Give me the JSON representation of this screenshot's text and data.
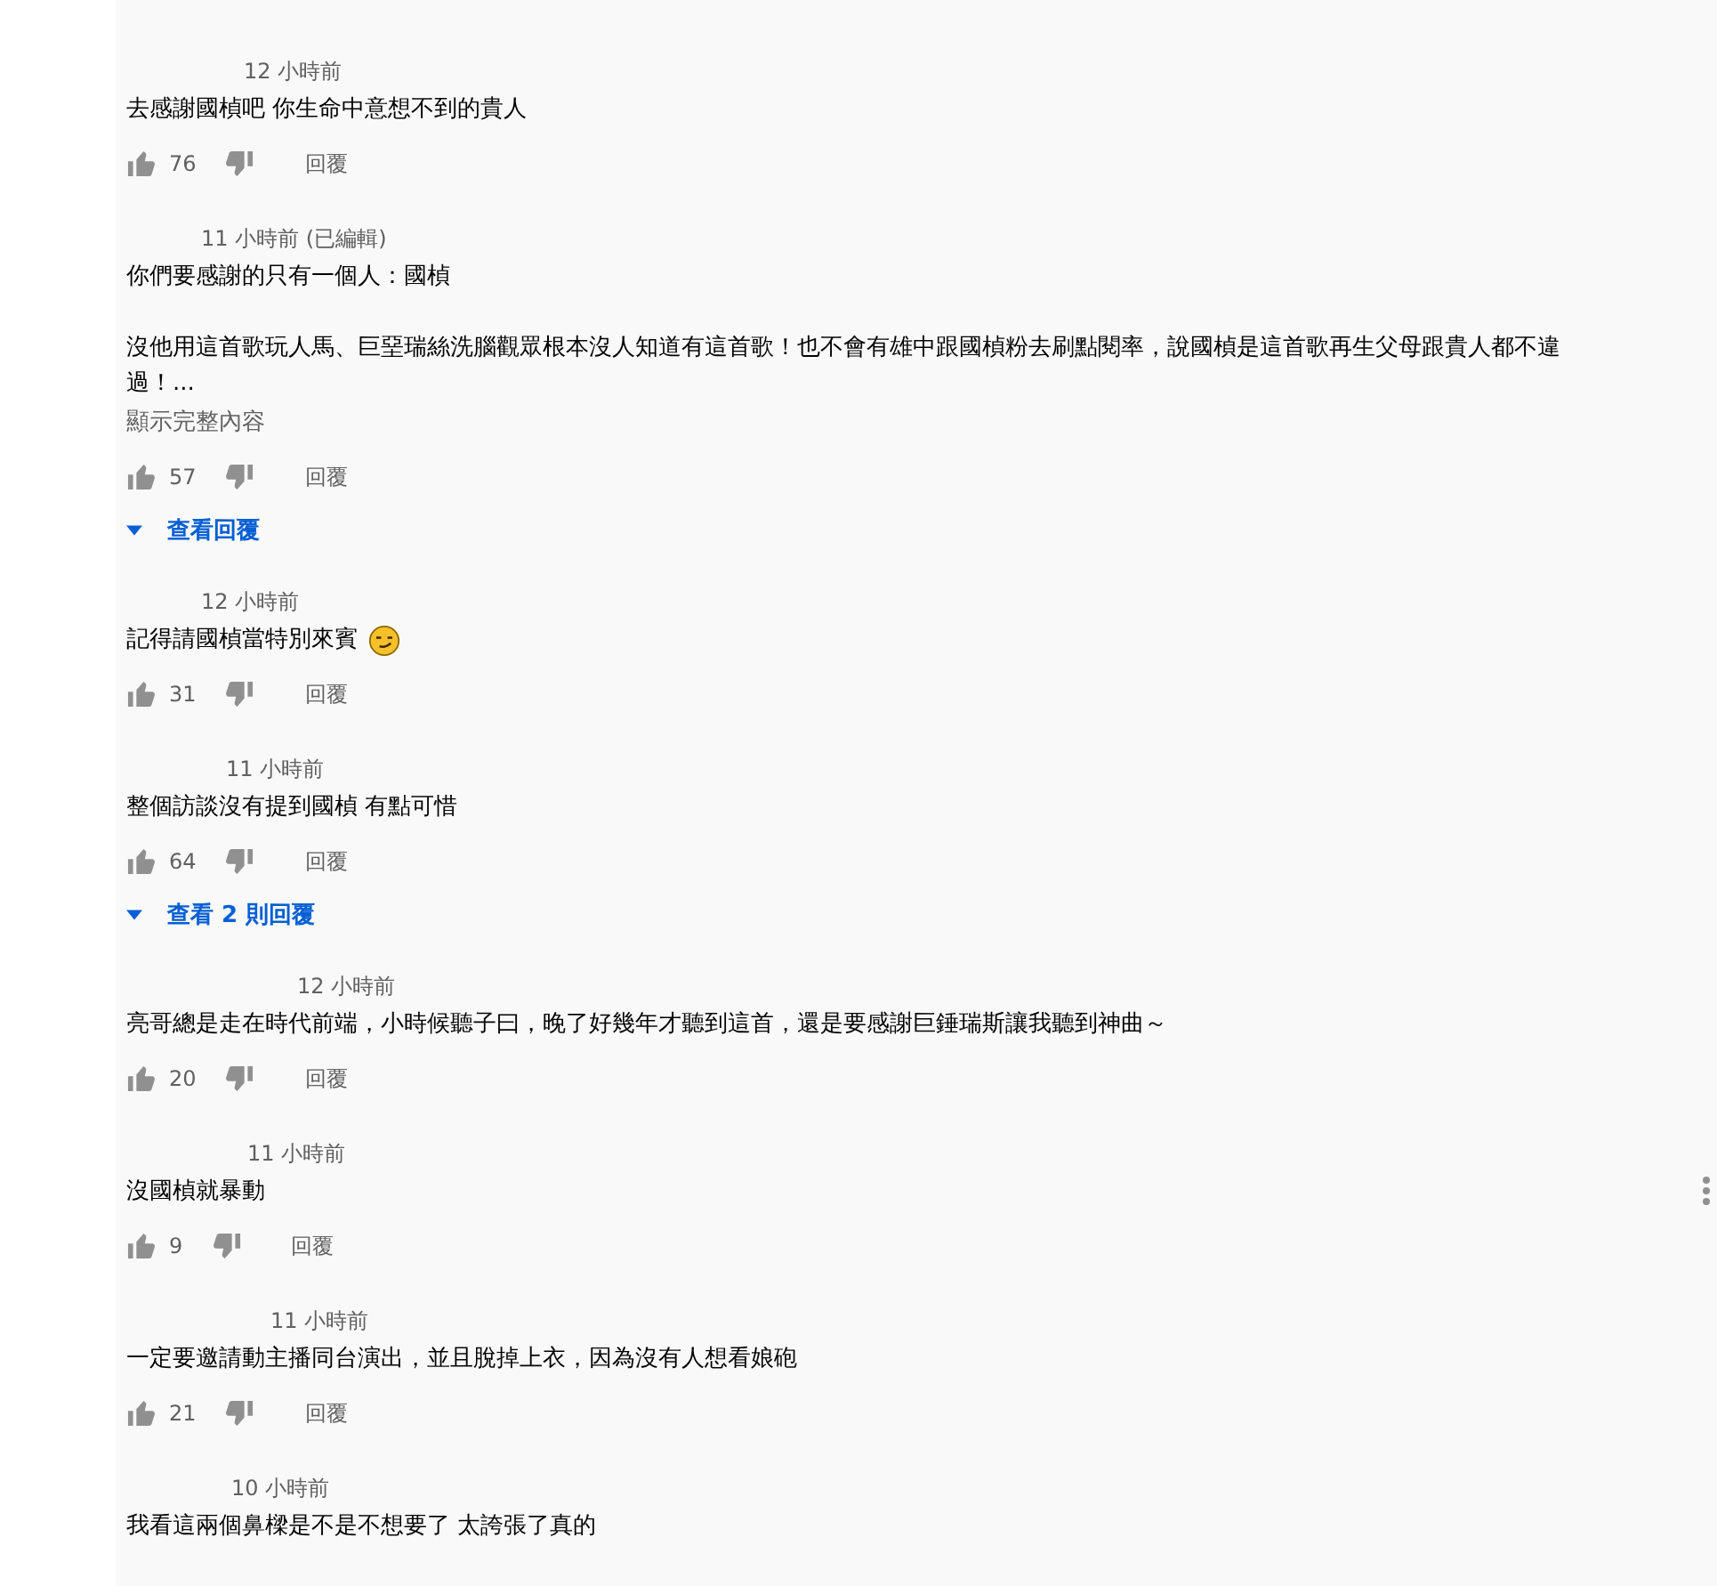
{
  "comments": [
    {
      "time": "12 小時前",
      "paragraphs": [
        "去感謝國楨吧 你生命中意想不到的貴人"
      ],
      "likes": "76",
      "reply": "回覆"
    },
    {
      "time": "11 小時前 (已編輯)",
      "paragraphs": [
        "你們要感謝的只有一個人：國楨",
        "沒他用這首歌玩人馬、巨堊瑞絲洗腦觀眾根本沒人知道有這首歌！也不會有雄中跟國楨粉去刷點閱率，說國楨是這首歌再生父母跟貴人都不違過！..."
      ],
      "show_more": "顯示完整內容",
      "likes": "57",
      "reply": "回覆",
      "replies_link": "查看回覆"
    },
    {
      "time": "12 小時前",
      "paragraphs": [
        "記得請國楨當特別來賓"
      ],
      "has_emoji": true,
      "likes": "31",
      "reply": "回覆"
    },
    {
      "time": "11 小時前",
      "paragraphs": [
        "整個訪談沒有提到國楨 有點可惜"
      ],
      "likes": "64",
      "reply": "回覆",
      "replies_link": "查看 2 則回覆"
    },
    {
      "time": "12 小時前",
      "paragraphs": [
        "亮哥總是走在時代前端，小時候聽子曰，晚了好幾年才聽到這首，還是要感謝巨錘瑞斯讓我聽到神曲～"
      ],
      "likes": "20",
      "reply": "回覆"
    },
    {
      "time": "11 小時前",
      "paragraphs": [
        "沒國楨就暴動"
      ],
      "likes": "9",
      "reply": "回覆"
    },
    {
      "time": "11 小時前",
      "paragraphs": [
        "一定要邀請動主播同台演出，並且脫掉上衣，因為沒有人想看娘砲"
      ],
      "likes": "21",
      "reply": "回覆"
    },
    {
      "time": "10 小時前",
      "paragraphs": [
        "我看這兩個鼻樑是不是不想要了 太誇張了真的"
      ]
    }
  ]
}
